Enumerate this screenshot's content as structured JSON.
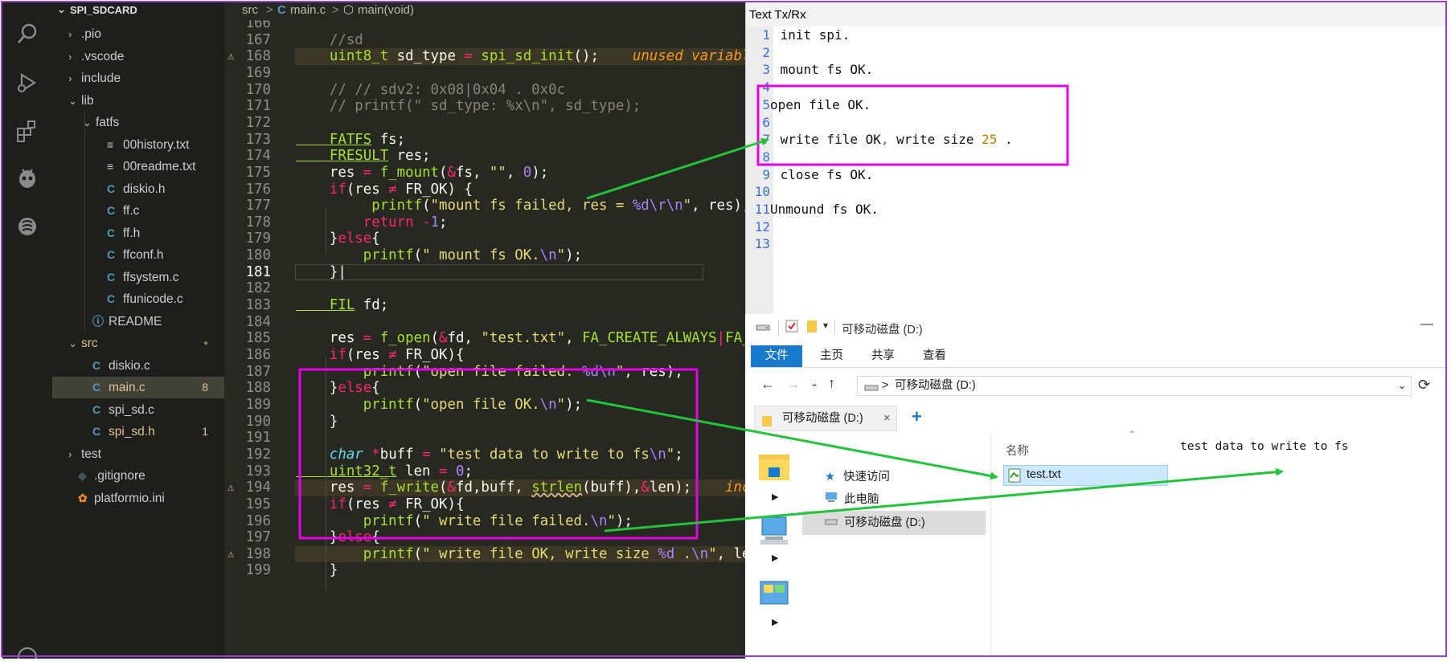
{
  "explorer": {
    "title": "SPI_SDCARD",
    "items": [
      {
        "name": ".pio",
        "kind": "folder",
        "expanded": false,
        "depth": 0
      },
      {
        "name": ".vscode",
        "kind": "folder",
        "expanded": false,
        "depth": 0
      },
      {
        "name": "include",
        "kind": "folder",
        "expanded": false,
        "depth": 0
      },
      {
        "name": "lib",
        "kind": "folder",
        "expanded": true,
        "depth": 0
      },
      {
        "name": "fatfs",
        "kind": "folder",
        "expanded": true,
        "depth": 1
      },
      {
        "name": "00history.txt",
        "kind": "txt",
        "depth": 2
      },
      {
        "name": "00readme.txt",
        "kind": "txt",
        "depth": 2
      },
      {
        "name": "diskio.h",
        "kind": "c",
        "depth": 2
      },
      {
        "name": "ff.c",
        "kind": "c",
        "depth": 2
      },
      {
        "name": "ff.h",
        "kind": "c",
        "depth": 2
      },
      {
        "name": "ffconf.h",
        "kind": "c",
        "depth": 2
      },
      {
        "name": "ffsystem.c",
        "kind": "c",
        "depth": 2
      },
      {
        "name": "ffunicode.c",
        "kind": "c",
        "depth": 2
      },
      {
        "name": "README",
        "kind": "info",
        "depth": 1
      },
      {
        "name": "src",
        "kind": "folder",
        "expanded": true,
        "depth": 0,
        "modified": true
      },
      {
        "name": "diskio.c",
        "kind": "c",
        "depth": 1
      },
      {
        "name": "main.c",
        "kind": "c",
        "depth": 1,
        "active": true,
        "badge": "8"
      },
      {
        "name": "spi_sd.c",
        "kind": "c",
        "depth": 1
      },
      {
        "name": "spi_sd.h",
        "kind": "c",
        "depth": 1,
        "badge": "1"
      },
      {
        "name": "test",
        "kind": "folder",
        "expanded": false,
        "depth": 0
      },
      {
        "name": ".gitignore",
        "kind": "git",
        "depth": 0
      },
      {
        "name": "platformio.ini",
        "kind": "pio",
        "depth": 0
      }
    ]
  },
  "breadcrumb": {
    "folder": "src",
    "sep": ">",
    "file": "main.c",
    "symbol": "main(void)",
    "file_icon": "C"
  },
  "editor": {
    "current_line": "181",
    "lines": [
      {
        "n": "166",
        "tok": []
      },
      {
        "n": "167",
        "tok": [
          [
            "cm",
            "    //sd"
          ]
        ]
      },
      {
        "n": "168",
        "warn": true,
        "tok": [
          [
            "ty",
            "    uint8_t"
          ],
          [
            "p",
            " sd_type "
          ],
          [
            "op",
            "="
          ],
          [
            "p",
            " "
          ],
          [
            "f",
            "spi_sd_init"
          ],
          [
            "p",
            "();"
          ],
          [
            "wn",
            "    unused variabl"
          ]
        ]
      },
      {
        "n": "169",
        "tok": []
      },
      {
        "n": "170",
        "tok": [
          [
            "cm",
            "    // // sdv2: 0x08|0x04 . 0x0c"
          ]
        ]
      },
      {
        "n": "171",
        "tok": [
          [
            "cm",
            "    // printf(\" sd_type: %x\\n\", sd_type);"
          ]
        ]
      },
      {
        "n": "172",
        "tok": []
      },
      {
        "n": "173",
        "tok": [
          [
            "ty",
            "    FATFS"
          ],
          [
            "p",
            " fs;"
          ]
        ]
      },
      {
        "n": "174",
        "tok": [
          [
            "ty",
            "    FRESULT"
          ],
          [
            "p",
            " res;"
          ]
        ]
      },
      {
        "n": "175",
        "tok": [
          [
            "p",
            "    res "
          ],
          [
            "op",
            "="
          ],
          [
            "p",
            " "
          ],
          [
            "f",
            "f_mount"
          ],
          [
            "p",
            "("
          ],
          [
            "op",
            "&"
          ],
          [
            "p",
            "fs, "
          ],
          [
            "s",
            "\"\""
          ],
          [
            "p",
            ", "
          ],
          [
            "n",
            "0"
          ],
          [
            "p",
            ");"
          ]
        ]
      },
      {
        "n": "176",
        "tok": [
          [
            "k",
            "    if"
          ],
          [
            "p",
            "(res "
          ],
          [
            "op",
            "≠"
          ],
          [
            "p",
            " FR_OK) {"
          ]
        ]
      },
      {
        "n": "177",
        "tok": [
          [
            "p",
            "         "
          ],
          [
            "f",
            "printf"
          ],
          [
            "p",
            "("
          ],
          [
            "s",
            "\"mount fs failed, res = "
          ],
          [
            "esc",
            "%d\\r\\n"
          ],
          [
            "s",
            "\""
          ],
          [
            "p",
            ", res);"
          ]
        ]
      },
      {
        "n": "178",
        "tok": [
          [
            "k",
            "        return"
          ],
          [
            "p",
            " "
          ],
          [
            "op",
            "-"
          ],
          [
            "n",
            "1"
          ],
          [
            "p",
            ";"
          ]
        ]
      },
      {
        "n": "179",
        "tok": [
          [
            "p",
            "    }"
          ],
          [
            "k",
            "else"
          ],
          [
            "p",
            "{"
          ]
        ]
      },
      {
        "n": "180",
        "tok": [
          [
            "p",
            "        "
          ],
          [
            "f",
            "printf"
          ],
          [
            "p",
            "("
          ],
          [
            "s",
            "\" mount fs OK."
          ],
          [
            "esc",
            "\\n"
          ],
          [
            "s",
            "\""
          ],
          [
            "p",
            ");"
          ]
        ]
      },
      {
        "n": "181",
        "tok": [
          [
            "p",
            "    }"
          ]
        ]
      },
      {
        "n": "182",
        "tok": []
      },
      {
        "n": "183",
        "tok": [
          [
            "ty",
            "    FIL"
          ],
          [
            "p",
            " fd;"
          ]
        ]
      },
      {
        "n": "184",
        "tok": []
      },
      {
        "n": "185",
        "tok": [
          [
            "p",
            "    res "
          ],
          [
            "op",
            "="
          ],
          [
            "p",
            " "
          ],
          [
            "f",
            "f_open"
          ],
          [
            "p",
            "("
          ],
          [
            "op",
            "&"
          ],
          [
            "p",
            "fd, "
          ],
          [
            "s",
            "\"test.txt\""
          ],
          [
            "p",
            ", "
          ],
          [
            "f",
            "FA_CREATE_ALWAYS"
          ],
          [
            "op",
            "|"
          ],
          [
            "f",
            "FA_"
          ]
        ]
      },
      {
        "n": "186",
        "tok": [
          [
            "k",
            "    if"
          ],
          [
            "p",
            "(res "
          ],
          [
            "op",
            "≠"
          ],
          [
            "p",
            " FR_OK){"
          ]
        ]
      },
      {
        "n": "187",
        "tok": [
          [
            "p",
            "        "
          ],
          [
            "f",
            "printf"
          ],
          [
            "p",
            "("
          ],
          [
            "s",
            "\"open file failed: "
          ],
          [
            "esc",
            "%d\\n"
          ],
          [
            "s",
            "\""
          ],
          [
            "p",
            ", res);"
          ]
        ]
      },
      {
        "n": "188",
        "tok": [
          [
            "p",
            "    }"
          ],
          [
            "k",
            "else"
          ],
          [
            "p",
            "{"
          ]
        ]
      },
      {
        "n": "189",
        "tok": [
          [
            "p",
            "        "
          ],
          [
            "f",
            "printf"
          ],
          [
            "p",
            "("
          ],
          [
            "s",
            "\"open file OK."
          ],
          [
            "esc",
            "\\n"
          ],
          [
            "s",
            "\""
          ],
          [
            "p",
            ");"
          ]
        ]
      },
      {
        "n": "190",
        "tok": [
          [
            "p",
            "    }"
          ]
        ]
      },
      {
        "n": "191",
        "tok": []
      },
      {
        "n": "192",
        "tok": [
          [
            "t",
            "    char"
          ],
          [
            "p",
            " "
          ],
          [
            "op",
            "*"
          ],
          [
            "p",
            "buff "
          ],
          [
            "op",
            "="
          ],
          [
            "p",
            " "
          ],
          [
            "s",
            "\"test data to write to fs"
          ],
          [
            "esc",
            "\\n"
          ],
          [
            "s",
            "\""
          ],
          [
            "p",
            ";"
          ]
        ]
      },
      {
        "n": "193",
        "tok": [
          [
            "ty",
            "    uint32_t"
          ],
          [
            "p",
            " len "
          ],
          [
            "op",
            "="
          ],
          [
            "p",
            " "
          ],
          [
            "n",
            "0"
          ],
          [
            "p",
            ";"
          ]
        ]
      },
      {
        "n": "194",
        "warn": true,
        "tok": [
          [
            "p",
            "    res "
          ],
          [
            "op",
            "="
          ],
          [
            "p",
            " "
          ],
          [
            "f",
            "f_write"
          ],
          [
            "p",
            "("
          ],
          [
            "op",
            "&"
          ],
          [
            "p",
            "fd,buff, "
          ],
          [
            "f",
            "strlen"
          ],
          [
            "p",
            "(buff),"
          ],
          [
            "op",
            "&"
          ],
          [
            "p",
            "len);"
          ],
          [
            "wn",
            "    inc"
          ]
        ]
      },
      {
        "n": "195",
        "tok": [
          [
            "k",
            "    if"
          ],
          [
            "p",
            "(res "
          ],
          [
            "op",
            "≠"
          ],
          [
            "p",
            " FR_OK){"
          ]
        ]
      },
      {
        "n": "196",
        "tok": [
          [
            "p",
            "        "
          ],
          [
            "f",
            "printf"
          ],
          [
            "p",
            "("
          ],
          [
            "s",
            "\" write file failed."
          ],
          [
            "esc",
            "\\n"
          ],
          [
            "s",
            "\""
          ],
          [
            "p",
            ");"
          ]
        ]
      },
      {
        "n": "197",
        "tok": [
          [
            "p",
            "    }"
          ],
          [
            "k",
            "else"
          ],
          [
            "p",
            "{"
          ]
        ]
      },
      {
        "n": "198",
        "warn": true,
        "tok": [
          [
            "p",
            "        "
          ],
          [
            "f",
            "printf"
          ],
          [
            "p",
            "("
          ],
          [
            "s",
            "\" write file OK, write size "
          ],
          [
            "esc",
            "%d"
          ],
          [
            "s",
            " ."
          ],
          [
            "esc",
            "\\n"
          ],
          [
            "s",
            "\""
          ],
          [
            "p",
            ", le"
          ]
        ]
      },
      {
        "n": "199",
        "tok": [
          [
            "p",
            "    }"
          ]
        ]
      }
    ]
  },
  "txrx": {
    "title": "Text Tx/Rx",
    "lines": [
      {
        "n": "1",
        "text": " init spi."
      },
      {
        "n": "2",
        "text": ""
      },
      {
        "n": "3",
        "text": " mount fs OK."
      },
      {
        "n": "4",
        "text": ""
      },
      {
        "n": "5",
        "text": "open file OK."
      },
      {
        "n": "6",
        "text": ""
      },
      {
        "n": "7",
        "text": " write file OK, write size 25 ."
      },
      {
        "n": "8",
        "text": ""
      },
      {
        "n": "9",
        "text": " close fs OK."
      },
      {
        "n": "10",
        "text": ""
      },
      {
        "n": "11",
        "text": "Unmound fs OK."
      },
      {
        "n": "12",
        "text": ""
      },
      {
        "n": "13",
        "text": ""
      }
    ]
  },
  "file_explorer": {
    "title": "可移动磁盘 (D:)",
    "minimize": "—",
    "qa_dropdown": "▾",
    "ribbon_tabs": [
      "文件",
      "主页",
      "共享",
      "查看"
    ],
    "address": "可移动磁盘 (D:)",
    "address_sep": ">",
    "tab_label": "可移动磁盘 (D:)",
    "tab_close": "×",
    "tab_add": "+",
    "nav": {
      "quick_access": "快速访问",
      "this_pc": "此电脑",
      "removable": "可移动磁盘 (D:)"
    },
    "column_name": "名称",
    "file": "test.txt",
    "preview_text": "test data to write to fs"
  },
  "colors": {
    "highlight_box": "#e600e6",
    "arrow": "#22c43a"
  }
}
